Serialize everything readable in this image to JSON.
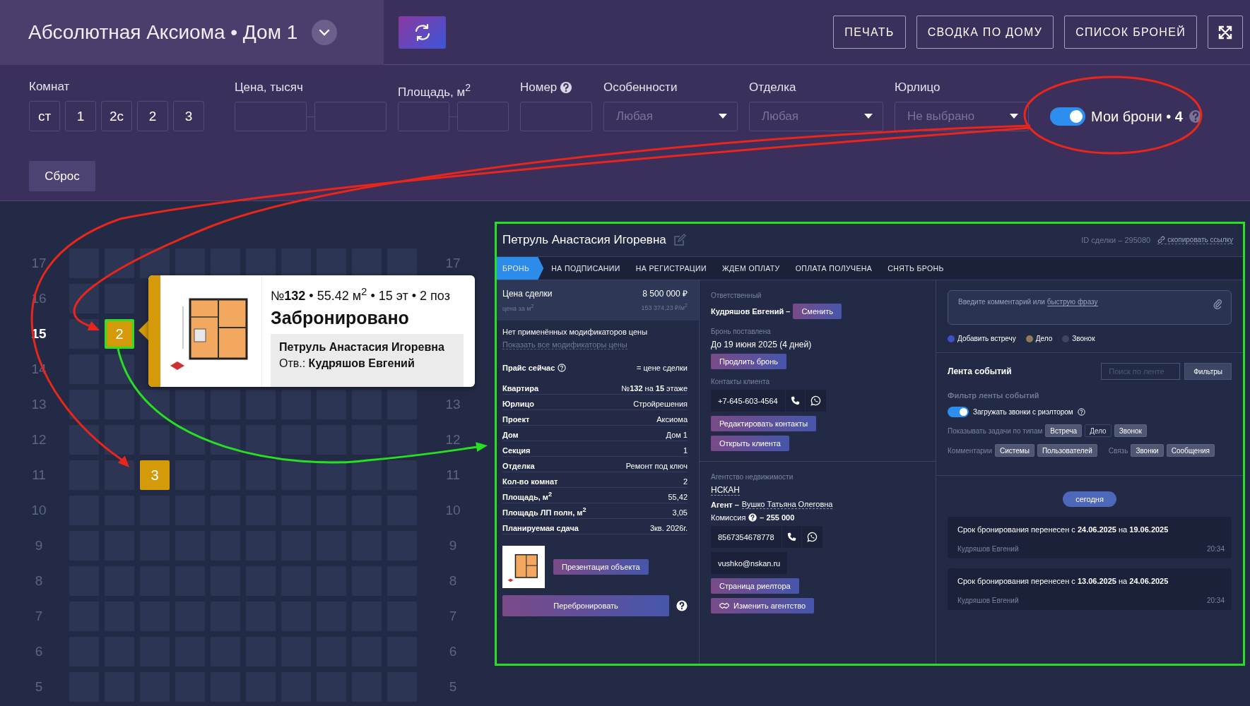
{
  "header": {
    "title": "Абсолютная Аксиома • Дом 1",
    "buttons": [
      "ПЕЧАТЬ",
      "СВОДКА ПО ДОМУ",
      "СПИСОК БРОНЕЙ"
    ]
  },
  "filters": {
    "rooms": {
      "label": "Комнат",
      "options": [
        {
          "label": "ст",
          "selected": false
        },
        {
          "label": "1",
          "selected": false
        },
        {
          "label": "2с",
          "selected": false
        },
        {
          "label": "2",
          "selected": false
        },
        {
          "label": "3",
          "selected": false
        }
      ]
    },
    "price": {
      "label": "Цена, тысяч"
    },
    "area": {
      "label": "Площадь, м$^{2}$"
    },
    "number": {
      "label": "Номер"
    },
    "selects": [
      {
        "label": "Особенности",
        "placeholder": "Любая"
      },
      {
        "label": "Отделка",
        "placeholder": "Любая"
      },
      {
        "label": "Юрлицо",
        "placeholder": "Не выбрано"
      }
    ],
    "my_bookings": {
      "label": "Мои брони • **4**",
      "on": true
    },
    "reset": "Сброс"
  },
  "floors": [
    {
      "label": "17",
      "selected": false,
      "right_label": "17",
      "units": [
        {
          "kind": "free",
          "selected": false
        },
        {
          "kind": "free",
          "selected": false
        },
        {
          "kind": "free",
          "selected": false
        },
        {
          "kind": "free",
          "selected": false
        },
        {
          "kind": "free",
          "selected": false
        },
        {
          "kind": "free",
          "selected": false
        },
        {
          "kind": "free",
          "selected": false
        },
        {
          "kind": "free",
          "selected": false
        },
        {
          "kind": "free",
          "selected": false
        },
        {
          "kind": "free",
          "selected": false
        }
      ]
    },
    {
      "label": "16",
      "selected": false,
      "units": [
        {
          "kind": "free",
          "selected": false
        },
        {
          "kind": "free",
          "selected": false
        }
      ]
    },
    {
      "label": "15",
      "selected": true,
      "units": [
        {
          "kind": "free",
          "selected": false
        },
        {
          "kind": "booked",
          "label": "2",
          "selected": true
        }
      ]
    },
    {
      "label": "14",
      "selected": false,
      "units": [
        {
          "kind": "free",
          "selected": false
        },
        {
          "kind": "free",
          "selected": false
        }
      ]
    },
    {
      "label": "13",
      "selected": false,
      "right_label": "13",
      "units": [
        {
          "kind": "free",
          "selected": false
        },
        {
          "kind": "free",
          "selected": false
        },
        {
          "kind": "free",
          "selected": false
        },
        {
          "kind": "free",
          "selected": false
        },
        {
          "kind": "free",
          "selected": false
        },
        {
          "kind": "free",
          "selected": false
        },
        {
          "kind": "free",
          "selected": false
        },
        {
          "kind": "free",
          "selected": false
        },
        {
          "kind": "free",
          "selected": false
        },
        {
          "kind": "free",
          "selected": false
        }
      ]
    },
    {
      "label": "12",
      "selected": false,
      "right_label": "12",
      "units": [
        {
          "kind": "free",
          "selected": false
        },
        {
          "kind": "free",
          "selected": false
        },
        {
          "kind": "free",
          "selected": false
        },
        {
          "kind": "free",
          "selected": false
        },
        {
          "kind": "free",
          "selected": false
        },
        {
          "kind": "free",
          "selected": false
        },
        {
          "kind": "free",
          "selected": false
        },
        {
          "kind": "free",
          "selected": false
        },
        {
          "kind": "free",
          "selected": false
        },
        {
          "kind": "free",
          "selected": false
        }
      ]
    },
    {
      "label": "11",
      "selected": false,
      "right_label": "11",
      "units": [
        {
          "kind": "free",
          "selected": false
        },
        {
          "kind": "free",
          "selected": false
        },
        {
          "kind": "booked",
          "label": "3",
          "selected": false
        },
        {
          "kind": "free",
          "selected": false
        },
        {
          "kind": "free",
          "selected": false
        },
        {
          "kind": "free",
          "selected": false
        },
        {
          "kind": "free",
          "selected": false
        },
        {
          "kind": "free",
          "selected": false
        },
        {
          "kind": "free",
          "selected": false
        },
        {
          "kind": "free",
          "selected": false
        }
      ]
    },
    {
      "label": "10",
      "selected": false,
      "right_label": "10",
      "units": [
        {
          "kind": "free",
          "selected": false
        },
        {
          "kind": "free",
          "selected": false
        },
        {
          "kind": "free",
          "selected": false
        },
        {
          "kind": "free",
          "selected": false
        },
        {
          "kind": "free",
          "selected": false
        },
        {
          "kind": "free",
          "selected": false
        },
        {
          "kind": "free",
          "selected": false
        },
        {
          "kind": "free",
          "selected": false
        },
        {
          "kind": "free",
          "selected": false
        },
        {
          "kind": "free",
          "selected": false
        }
      ]
    },
    {
      "label": "9",
      "selected": false,
      "right_label": "9",
      "units": [
        {
          "kind": "free",
          "selected": false
        },
        {
          "kind": "free",
          "selected": false
        },
        {
          "kind": "free",
          "selected": false
        },
        {
          "kind": "free",
          "selected": false
        },
        {
          "kind": "free",
          "selected": false
        },
        {
          "kind": "free",
          "selected": false
        },
        {
          "kind": "free",
          "selected": false
        },
        {
          "kind": "free",
          "selected": false
        },
        {
          "kind": "free",
          "selected": false
        },
        {
          "kind": "free",
          "selected": false
        }
      ]
    },
    {
      "label": "8",
      "selected": false,
      "right_label": "8",
      "units": [
        {
          "kind": "free",
          "selected": false
        },
        {
          "kind": "free",
          "selected": false
        },
        {
          "kind": "free",
          "selected": false
        },
        {
          "kind": "free",
          "selected": false
        },
        {
          "kind": "free",
          "selected": false
        },
        {
          "kind": "free",
          "selected": false
        },
        {
          "kind": "free",
          "selected": false
        },
        {
          "kind": "free",
          "selected": false
        },
        {
          "kind": "free",
          "selected": false
        },
        {
          "kind": "free",
          "selected": false
        }
      ]
    },
    {
      "label": "7",
      "selected": false,
      "right_label": "7",
      "units": [
        {
          "kind": "free",
          "selected": false
        },
        {
          "kind": "free",
          "selected": false
        },
        {
          "kind": "free",
          "selected": false
        },
        {
          "kind": "free",
          "selected": false
        },
        {
          "kind": "free",
          "selected": false
        },
        {
          "kind": "free",
          "selected": false
        },
        {
          "kind": "free",
          "selected": false
        },
        {
          "kind": "free",
          "selected": false
        },
        {
          "kind": "free",
          "selected": false
        },
        {
          "kind": "free",
          "selected": false
        }
      ]
    },
    {
      "label": "6",
      "selected": false,
      "right_label": "6",
      "units": [
        {
          "kind": "free",
          "selected": false
        },
        {
          "kind": "free",
          "selected": false
        },
        {
          "kind": "free",
          "selected": false
        },
        {
          "kind": "free",
          "selected": false
        },
        {
          "kind": "free",
          "selected": false
        },
        {
          "kind": "free",
          "selected": false
        },
        {
          "kind": "free",
          "selected": false
        },
        {
          "kind": "free",
          "selected": false
        },
        {
          "kind": "free",
          "selected": false
        },
        {
          "kind": "free",
          "selected": false
        }
      ]
    },
    {
      "label": "5",
      "selected": false,
      "right_label": "5",
      "units": [
        {
          "kind": "free",
          "selected": false
        },
        {
          "kind": "free",
          "selected": false
        },
        {
          "kind": "free",
          "selected": false
        },
        {
          "kind": "free",
          "selected": false
        },
        {
          "kind": "free",
          "selected": false
        },
        {
          "kind": "free",
          "selected": false
        },
        {
          "kind": "free",
          "selected": false
        },
        {
          "kind": "free",
          "selected": false
        },
        {
          "kind": "free",
          "selected": false
        },
        {
          "kind": "free",
          "selected": false
        }
      ]
    }
  ],
  "popup": {
    "title": "№**132** • 55.42 м$^{2}$ • 15 эт • 2 поз",
    "status": "Забронировано",
    "client": "Петруль Анастасия Игоревна",
    "responsible": "Отв.: **Кудряшов Евгений**"
  },
  "deal": {
    "client": "Петруль Анастасия Игоревна",
    "deal_id": "ID сделки – 295080",
    "copy_link": "скопировать ссылку",
    "stages": [
      {
        "label": "БРОНЬ",
        "selected": true
      },
      {
        "label": "НА ПОДПИСАНИИ",
        "selected": false
      },
      {
        "label": "НА РЕГИСТРАЦИИ",
        "selected": false
      },
      {
        "label": "ЖДЕМ ОПЛАТУ",
        "selected": false
      },
      {
        "label": "ОПЛАТА ПОЛУЧЕНА",
        "selected": false
      },
      {
        "label": "СНЯТЬ БРОНЬ",
        "selected": false
      }
    ],
    "price": {
      "label": "Цена сделки",
      "value": "8 500 000 ₽",
      "per_m2_label": "цена за м$^{2}$",
      "per_m2_value": "153 374,23 ₽/м$^{2}$"
    },
    "modifiers_note": "Нет применённых модификаторов цены",
    "modifiers_link": "Показать все модификаторы цены",
    "price_now": {
      "label": "Прайс сейчас",
      "value": "= цене сделки"
    },
    "specs": [
      {
        "label": "Квартира",
        "value": "№**132** на **15** этаже"
      },
      {
        "label": "Юрлицо",
        "value": "Стройрешения"
      },
      {
        "label": "Проект",
        "value": "Аксиома"
      },
      {
        "label": "Дом",
        "value": "Дом 1"
      },
      {
        "label": "Секция",
        "value": "1"
      },
      {
        "label": "Отделка",
        "value": "Ремонт под ключ"
      },
      {
        "label": "Кол-во комнат",
        "value": "2"
      },
      {
        "label": "Площадь, м$^{2}$",
        "value": "55,42"
      },
      {
        "label": "Площадь ЛП полн, м$^{2}$",
        "value": "3,05"
      },
      {
        "label": "Планируемая сдача",
        "value": "3кв. 2026г."
      }
    ],
    "presentation_button": "Презентация объекта",
    "rebook_button": "Перебронировать",
    "responsible": {
      "label": "Ответственный",
      "name": "Кудряшов Евгений –",
      "button": "Сменить"
    },
    "booking": {
      "label": "Бронь поставлена",
      "until": "До 19 июня 2025 (4 дней)",
      "button": "Продлить бронь"
    },
    "contacts": {
      "label": "Контакты клиента",
      "phone": "+7-645-603-4564",
      "edit_button": "Редактировать контакты",
      "open_button": "Открыть клиента"
    },
    "agency": {
      "label": "Агентство недвижимости",
      "name": "НСКАН",
      "agent_label": "Агент –",
      "agent_name": "Вушко Татьяна Олеговна",
      "commission_label": "Комиссия",
      "commission": "– 255 000",
      "phone": "8567354678778",
      "email": "vushko@nskan.ru",
      "realtor_button": "Страница риелтора",
      "change_button": "Изменить агентство"
    },
    "comment": {
      "placeholder": "Введите комментарий или",
      "quick_phrase_link": "быструю фразу"
    },
    "task_types": [
      {
        "label": "Добавить встречу",
        "color": "#3f51c8"
      },
      {
        "label": "Дело",
        "color": "#8b7a5e"
      },
      {
        "label": "Звонок",
        "color": "#3d4663"
      }
    ],
    "feed": {
      "title": "Лента событий",
      "search_placeholder": "Поиск по ленте",
      "filters_button": "Фильтры",
      "filter_title": "Фильтр ленты событий",
      "load_calls": {
        "label": "Загружать звонки с риэлтором",
        "on": true
      },
      "task_filter": {
        "label": "Показывать задачи по типам",
        "chips": [
          {
            "label": "Встреча",
            "selected": true
          },
          {
            "label": "Дело",
            "selected": false
          },
          {
            "label": "Звонок",
            "selected": true
          }
        ]
      },
      "comments_filter": {
        "label": "Комментарии",
        "chips": [
          {
            "label": "Системы",
            "selected": true
          },
          {
            "label": "Пользователей",
            "selected": true
          }
        ]
      },
      "link_filter": {
        "label": "Связь",
        "chips": [
          {
            "label": "Звонки",
            "selected": true
          },
          {
            "label": "Сообщения",
            "selected": true
          }
        ]
      },
      "day": "сегодня",
      "events": [
        {
          "text": "Срок бронирования перенесен с **24.06.2025** на **19.06.2025**",
          "author": "Кудряшов Евгений",
          "time": "20:34"
        },
        {
          "text": "Срок бронирования перенесен с **13.06.2025** на **24.06.2025**",
          "author": "Кудряшов Евгений",
          "time": "20:34"
        }
      ]
    }
  }
}
